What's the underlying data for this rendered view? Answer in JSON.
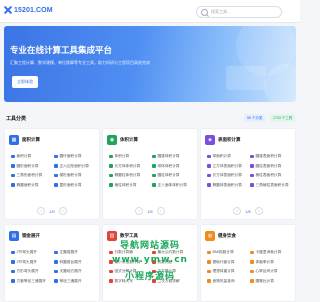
{
  "header": {
    "logo_text": "15201.COM",
    "search_placeholder": "搜索工具..."
  },
  "hero": {
    "title": "专业在线计算工具集成平台",
    "subtitle": "汇聚工程计算、数学建模、单位换算等专业工具，助力科研与工程项目高效完成",
    "button": "立即体验"
  },
  "section": {
    "title": "工具分类",
    "stat1": "56 个分类",
    "stat2": "2703 个工具"
  },
  "cards": [
    {
      "title": "面积计算",
      "color": "#2f6fe8",
      "items": [
        "面积计算",
        "圆环面积计算",
        "圆形面积计算",
        "正六边形面积计算",
        "三角形面积计算",
        "梯形面积计算",
        "椭圆面积计算",
        "菱形面积计算"
      ],
      "pager": "1/9"
    },
    {
      "title": "体积计算",
      "color": "#22a35a",
      "items": [
        "体积计算",
        "圆锥体积计算",
        "长方体体积计算",
        "球体体积计算",
        "椭圆柱体积计算",
        "圆柱体积计算",
        "棱柱体积计算",
        "正八面体体积计算"
      ],
      "pager": "1/6"
    },
    {
      "title": "表面积计算",
      "color": "#7a4fe0",
      "items": [
        "球面积计算",
        "圆锥表面积计算",
        "立方体表面积计算",
        "圆柱表面积计算",
        "长方体表面积计算",
        "棱柱表面积计算",
        "椭圆体表面积计算",
        "三角棱柱表面积计算"
      ],
      "pager": "1/5"
    },
    {
      "title": "钢金展开",
      "color": "#2f6fe8",
      "items": [
        "2节弯头展开",
        "正圆锥展开",
        "3节弯头展开",
        "斜圆锥台展开",
        "方形弯头展开",
        "天圆地方展开",
        "方管等径三通展开",
        "等径三通展开"
      ]
    },
    {
      "title": "数学工具",
      "color": "#e0453d",
      "items": [
        "分数计算器",
        "最大公约数计算",
        "最小公倍数计算",
        "质数判断",
        "因式分解计算",
        "平方根计算",
        "数字转大写",
        "二次方程求解"
      ]
    },
    {
      "title": "健身饮食",
      "color": "#f08c1a",
      "items": [
        "BMI指数计算",
        "卡路里消耗计算",
        "基础代谢计算",
        "体脂率计算",
        "理想体重计算",
        "心率区间计算",
        "食物热量查询",
        "腰臀比计算"
      ]
    }
  ],
  "watermark": {
    "line1": "导航网站源码",
    "line2": "www.ymw.cn",
    "line3": "小程序源码"
  }
}
